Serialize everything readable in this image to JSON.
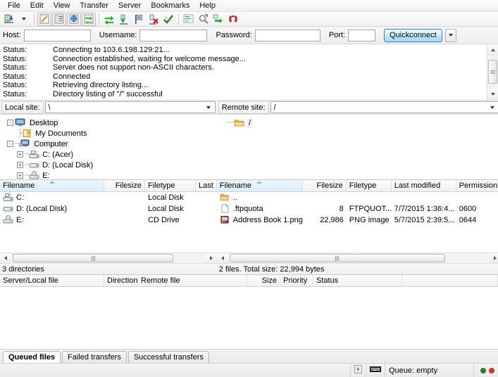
{
  "menu": {
    "items": [
      "File",
      "Edit",
      "View",
      "Transfer",
      "Server",
      "Bookmarks",
      "Help"
    ]
  },
  "toolbar": {
    "buttons": [
      {
        "name": "site-manager-icon",
        "label": "Open the Site Manager"
      },
      {
        "name": "site-manager-dropdown-icon",
        "label": "Site Manager dropdown"
      },
      {
        "name": "toggle-message-log-icon",
        "label": "Toggle message log"
      },
      {
        "name": "toggle-local-tree-icon",
        "label": "Toggle local directory tree"
      },
      {
        "name": "toggle-remote-tree-icon",
        "label": "Toggle remote directory tree"
      },
      {
        "name": "toggle-transfer-queue-icon",
        "label": "Toggle transfer queue"
      },
      {
        "name": "refresh-icon",
        "label": "Refresh the file and folder lists"
      },
      {
        "name": "process-queue-icon",
        "label": "Process queue"
      },
      {
        "name": "toggle-bookmark-icon",
        "label": "Toggle bookmark"
      },
      {
        "name": "cancel-operation-icon",
        "label": "Cancel current operation"
      },
      {
        "name": "disconnect-icon",
        "label": "Disconnect from server"
      },
      {
        "name": "filter-icon",
        "label": "Open directory listing filters"
      },
      {
        "name": "compare-directories-icon",
        "label": "Directory comparison"
      },
      {
        "name": "synchronized-browsing-icon",
        "label": "Synchronized browsing"
      },
      {
        "name": "find-files-icon",
        "label": "Search remote files"
      }
    ]
  },
  "quickconnect": {
    "host_label": "Host:",
    "host_value": "",
    "username_label": "Username:",
    "username_value": "",
    "password_label": "Password:",
    "password_value": "",
    "port_label": "Port:",
    "port_value": "",
    "button_label": "Quickconnect"
  },
  "log": {
    "rows": [
      {
        "label": "Status:",
        "message": "Connecting to 103.6.198.129:21..."
      },
      {
        "label": "Status:",
        "message": "Connection established, waiting for welcome message..."
      },
      {
        "label": "Status:",
        "message": "Server does not support non-ASCII characters."
      },
      {
        "label": "Status:",
        "message": "Connected"
      },
      {
        "label": "Status:",
        "message": "Retrieving directory listing..."
      },
      {
        "label": "Status:",
        "message": "Directory listing of \"/\" successful"
      }
    ]
  },
  "local": {
    "site_label": "Local site:",
    "site_value": "\\",
    "tree": [
      {
        "label": "Desktop",
        "depth": 0,
        "expander": "-",
        "icon": "desktop-icon"
      },
      {
        "label": "My Documents",
        "depth": 1,
        "expander": "",
        "icon": "documents-folder-icon"
      },
      {
        "label": "Computer",
        "depth": 1,
        "expander": "-",
        "icon": "computer-icon"
      },
      {
        "label": "C: (Acer)",
        "depth": 2,
        "expander": "+",
        "icon": "hard-drive-icon"
      },
      {
        "label": "D: (Local Disk)",
        "depth": 2,
        "expander": "+",
        "icon": "local-disk-icon"
      },
      {
        "label": "E:",
        "depth": 2,
        "expander": "+",
        "icon": "cd-drive-icon"
      }
    ],
    "columns": [
      "Filename",
      "Filesize",
      "Filetype",
      "Last"
    ],
    "rows": [
      {
        "filename": "C:",
        "filesize": "",
        "filetype": "Local Disk",
        "last": "",
        "icon": "hard-drive-icon"
      },
      {
        "filename": "D: (Local Disk)",
        "filesize": "",
        "filetype": "Local Disk",
        "last": "",
        "icon": "local-disk-icon"
      },
      {
        "filename": "E:",
        "filesize": "",
        "filetype": "CD Drive",
        "last": "",
        "icon": "cd-drive-icon"
      }
    ],
    "status": "3 directories"
  },
  "remote": {
    "site_label": "Remote site:",
    "site_value": "/",
    "tree": [
      {
        "label": "/",
        "depth": 0,
        "expander": "",
        "icon": "folder-icon"
      }
    ],
    "columns": [
      "Filename",
      "Filesize",
      "Filetype",
      "Last modified",
      "Permission"
    ],
    "rows": [
      {
        "filename": "..",
        "filesize": "",
        "filetype": "",
        "modified": "",
        "permission": "",
        "icon": "parent-folder-icon"
      },
      {
        "filename": ".ftpquota",
        "filesize": "8",
        "filetype": "FTPQUOT...",
        "modified": "7/7/2015 1:36:4...",
        "permission": "0600",
        "icon": "generic-file-icon"
      },
      {
        "filename": "Address Book 1.png",
        "filesize": "22,986",
        "filetype": "PNG image",
        "modified": "5/7/2015 2:39:5...",
        "permission": "0644",
        "icon": "png-image-icon"
      }
    ],
    "status": "2 files. Total size: 22,994 bytes"
  },
  "queue": {
    "columns": [
      "Server/Local file",
      "Direction",
      "Remote file",
      "Size",
      "Priority",
      "Status"
    ],
    "rows": [],
    "tabs": [
      {
        "label": "Queued files",
        "active": true
      },
      {
        "label": "Failed transfers",
        "active": false
      },
      {
        "label": "Successful transfers",
        "active": false
      }
    ]
  },
  "statusbar": {
    "security_icon": "not-secure-icon",
    "encryption_icon": "keyboard-icon",
    "queue_text": "Queue: empty",
    "indicator_colors": [
      "#2f7a2f",
      "#c03a2b"
    ]
  },
  "colors": {
    "accent": "#3c7fb1",
    "header_sorted": "#d9eefb",
    "window_bg": "#f0f0f0"
  }
}
